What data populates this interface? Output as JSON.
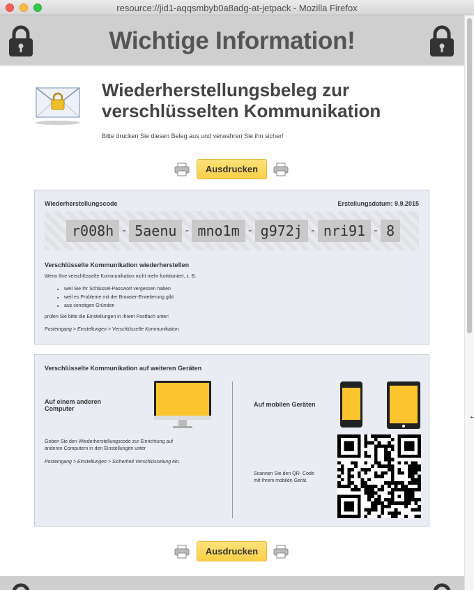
{
  "window": {
    "title": "resource://jid1-aqqsmbyb0a8adg-at-jetpack - Mozilla Firefox"
  },
  "header": {
    "title": "Wichtige Information!"
  },
  "intro": {
    "title_line1": "Wiederherstellungsbeleg zur",
    "title_line2": "verschlüsselten Kommunikation",
    "subtitle": "Bitte drucken Sie diesen Beleg aus und verwahren Sie ihn sicher!"
  },
  "print": {
    "button_label": "Ausdrucken"
  },
  "recovery": {
    "heading": "Wiederherstellungscode",
    "date_label": "Erstellungsdatum: 9.9.2015",
    "code_segments": [
      "r008h",
      "5aenu",
      "mno1m",
      "g972j",
      "nri91",
      "8"
    ],
    "restore_heading": "Verschlüsselte Kommunikation wiederherstellen",
    "restore_intro": "Wenn Ihre verschlüsselte Kommunikation nicht mehr funktioniert, z. B.",
    "reasons": [
      "weil Sie Ihr Schlüssel-Passwort vergessen haben",
      "weil es Probleme mit der Browser-Erweiterung gibt",
      "aus sonstigen Gründen"
    ],
    "check_text": "prüfen Sie bitte die Einstellungen in Ihrem Postfach unter:",
    "path": "Posteingang > Einstellungen > Verschlüsselte Kommunikation."
  },
  "devices": {
    "heading": "Verschlüsselte Kommunikation auf weiteren Geräten",
    "computer_label_line1": "Auf einem anderen",
    "computer_label_line2": "Computer",
    "computer_text_line1": "Geben Sie den Wiederherstellungscode zur Einrichtung auf",
    "computer_text_line2": "anderen Computern in den Einstellungen unter",
    "computer_path": "Posteingang > Einstellungen > Sicherheit Verschlüsselung ein.",
    "mobile_label": "Auf mobilen Geräten",
    "qr_text_line1": "Scannen Sie den QR- Code",
    "qr_text_line2": "mit Ihrem mobilen Gerät."
  },
  "colors": {
    "button": "#fbcf48",
    "screen": "#fcc52f",
    "box": "#e9ecf3",
    "header": "#cfcfcf"
  }
}
